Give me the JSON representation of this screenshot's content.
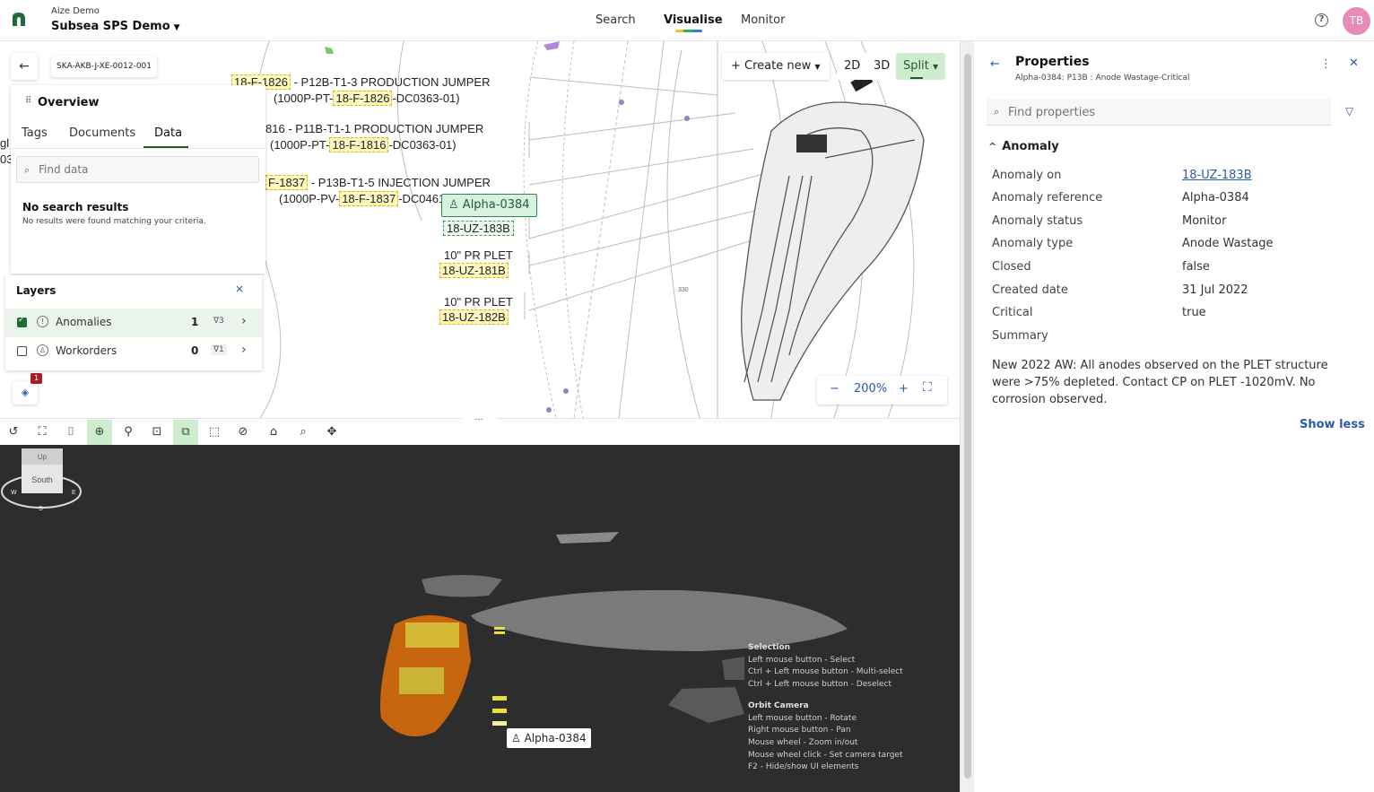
{
  "header": {
    "org": "Aize Demo",
    "project": "Subsea SPS Demo",
    "nav": {
      "search": "Search",
      "visualise": "Visualise",
      "monitor": "Monitor"
    },
    "help_glyph": "?",
    "avatar_initials": "TB"
  },
  "map": {
    "asset_code": "SKA-AKB-J-XE-0012-001",
    "labels": {
      "jumper1_tag": "18-F-1826",
      "jumper1_title": "- P12B-T1-3 PRODUCTION JUMPER",
      "jumper1_line_prefix": "(1000P-PT-",
      "jumper1_line_tag": "18-F-1826",
      "jumper1_line_suffix": "-DC0363-01)",
      "jumper2_tag": "816",
      "jumper2_title": "- P11B-T1-1 PRODUCTION JUMPER",
      "jumper2_line_prefix": "(1000P-PT-",
      "jumper2_line_tag": "18-F-1816",
      "jumper2_line_suffix": "-DC0363-01)",
      "jumper3_tag": "F-1837",
      "jumper3_title": "- P13B-T1-5 INJECTION JUMPER",
      "jumper3_line_prefix": "(1000P-PV-",
      "jumper3_line_tag": "18-F-1837",
      "jumper3_line_suffix": "-DC0461-",
      "alpha_chip": "Alpha-0384",
      "uz183b": "18-UZ-183B",
      "plet1_title": "10\" PR PLET",
      "plet1_tag": "18-UZ-181B",
      "plet2_title": "10\" PR PLET",
      "plet2_tag": "18-UZ-182B",
      "edge1": "gl",
      "edge2": "03",
      "contour": "330"
    },
    "create_new": "Create new",
    "view_2d": "2D",
    "view_3d": "3D",
    "view_split": "Split",
    "zoom": {
      "minus": "−",
      "level": "200%",
      "plus": "+"
    }
  },
  "overview": {
    "title": "Overview",
    "tabs": [
      "Tags",
      "Documents",
      "Data"
    ],
    "active_tab": "Data",
    "search_placeholder": "Find data",
    "no_results_title": "No search results",
    "no_results_sub": "No results were found matching your criteria."
  },
  "layers": {
    "title": "Layers",
    "close": "×",
    "items": [
      {
        "label": "Anomalies",
        "count": "1",
        "filter": "∇3",
        "checked": true
      },
      {
        "label": "Workorders",
        "count": "0",
        "filter": "∇1",
        "checked": false
      }
    ],
    "badge": "1"
  },
  "toolbar": {
    "handle": "..."
  },
  "viewer3d": {
    "alpha_label": "Alpha-0384",
    "help": {
      "selection_title": "Selection",
      "selection_lines": [
        "Left mouse button - Select",
        "Ctrl + Left mouse button - Multi-select",
        "Ctrl + Left mouse button - Deselect"
      ],
      "orbit_title": "Orbit Camera",
      "orbit_lines": [
        "Left mouse button - Rotate",
        "Right mouse button - Pan",
        "Mouse wheel - Zoom in/out",
        "Mouse wheel click - Set camera target",
        "F2 - Hide/show UI elements"
      ]
    },
    "navcube": {
      "up": "Up",
      "south": "South",
      "w": "W",
      "e": "E",
      "s": "S"
    }
  },
  "properties": {
    "title": "Properties",
    "subtitle": "Alpha-0384: P13B : Anode Wastage-Critical",
    "search_placeholder": "Find properties",
    "section": "Anomaly",
    "rows": [
      {
        "label": "Anomaly on",
        "value": "18-UZ-183B"
      },
      {
        "label": "Anomaly reference",
        "value": "Alpha-0384"
      },
      {
        "label": "Anomaly status",
        "value": "Monitor"
      },
      {
        "label": "Anomaly type",
        "value": "Anode Wastage"
      },
      {
        "label": "Closed",
        "value": "false"
      },
      {
        "label": "Created date",
        "value": "31 Jul 2022"
      },
      {
        "label": "Critical",
        "value": "true"
      },
      {
        "label": "Summary",
        "value": ""
      }
    ],
    "summary": "New 2022 AW: All anodes observed on the PLET structure were >75% depleted. Contact CP on PLET -1020mV. No corrosion observed.",
    "show_less": "Show less"
  },
  "colors": {
    "accent": "#1e5c2f",
    "link": "#2a5caa",
    "avatar": "#e88bb5",
    "viewer_bg": "#2d2d2d"
  }
}
